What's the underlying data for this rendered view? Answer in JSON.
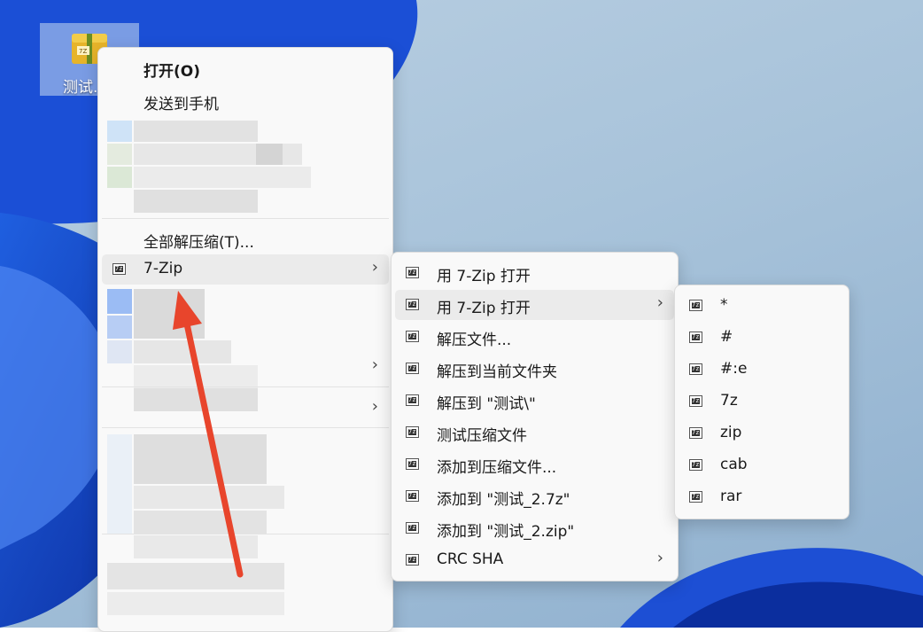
{
  "desktop_icon": {
    "label": "测试."
  },
  "context_menu": {
    "open": "打开(O)",
    "send_to_phone": "发送到手机",
    "extract_all": "全部解压缩(T)...",
    "seven_zip": "7-Zip",
    "submenu_arrow": "›"
  },
  "seven_zip_menu": {
    "items": [
      {
        "label": "用 7-Zip 打开",
        "has_submenu": false
      },
      {
        "label": "用 7-Zip 打开",
        "has_submenu": true
      },
      {
        "label": "解压文件...",
        "has_submenu": false
      },
      {
        "label": "解压到当前文件夹",
        "has_submenu": false
      },
      {
        "label": "解压到 \"测试\\\"",
        "has_submenu": false
      },
      {
        "label": "测试压缩文件",
        "has_submenu": false
      },
      {
        "label": "添加到压缩文件...",
        "has_submenu": false
      },
      {
        "label": "添加到 \"测试_2.7z\"",
        "has_submenu": false
      },
      {
        "label": "添加到 \"测试_2.zip\"",
        "has_submenu": false
      },
      {
        "label": "CRC SHA",
        "has_submenu": true
      }
    ]
  },
  "open_with_menu": {
    "items": [
      {
        "label": "*"
      },
      {
        "label": "#"
      },
      {
        "label": "#:e"
      },
      {
        "label": "7z"
      },
      {
        "label": "zip"
      },
      {
        "label": "cab"
      },
      {
        "label": "rar"
      }
    ]
  },
  "colors": {
    "annotation_arrow": "#e8452c",
    "menu_bg": "#f9f9f9",
    "highlight": "#ebebeb"
  }
}
